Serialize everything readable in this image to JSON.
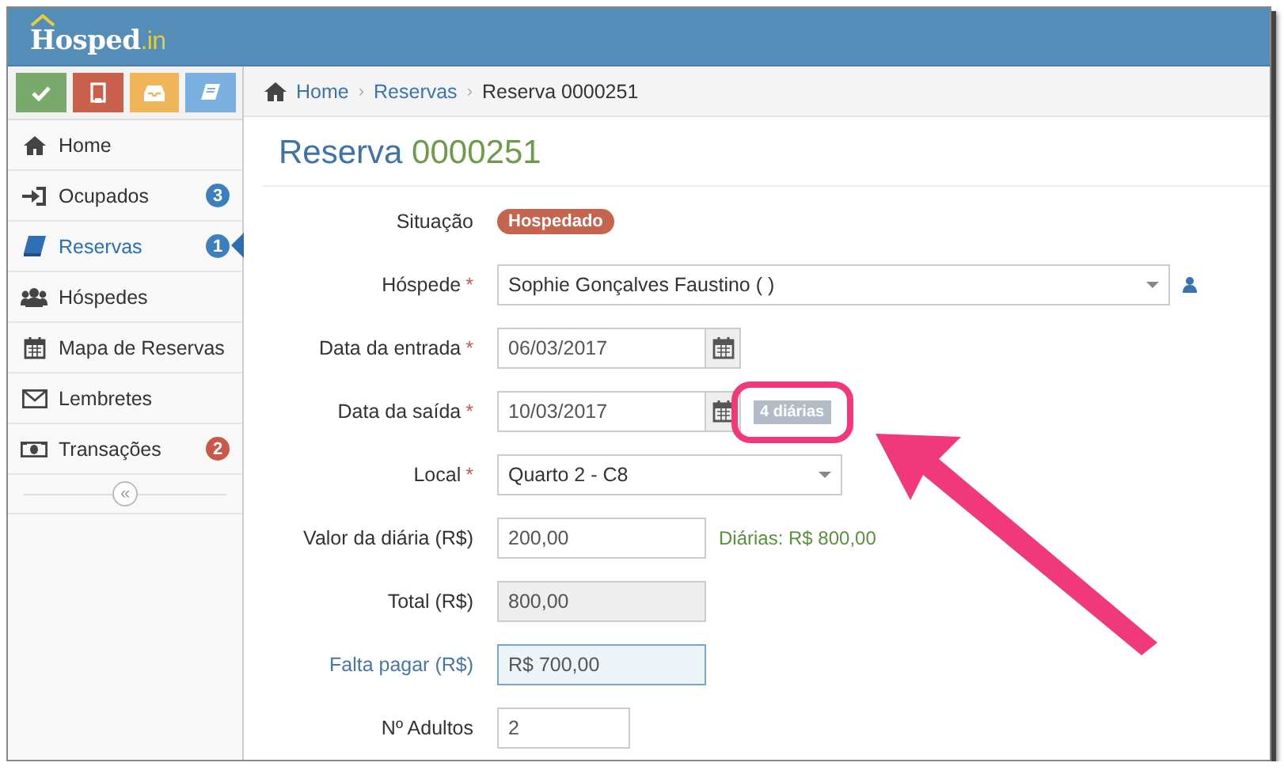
{
  "header": {
    "logo": "Hosped",
    "logo_suffix": ".in"
  },
  "quick_actions": [
    {
      "color": "#7aa96c"
    },
    {
      "color": "#c9604b"
    },
    {
      "color": "#f0b459"
    },
    {
      "color": "#7ab0df"
    }
  ],
  "sidebar": {
    "items": [
      {
        "label": "Home",
        "selected": false
      },
      {
        "label": "Ocupados",
        "selected": false,
        "count": "3",
        "color": "#3b7fbf"
      },
      {
        "label": "Reservas",
        "selected": true,
        "count": "1",
        "color": "#3b7fbf"
      },
      {
        "label": "Hóspedes",
        "selected": false
      },
      {
        "label": "Mapa de Reservas",
        "selected": false
      },
      {
        "label": "Lembretes",
        "selected": false
      },
      {
        "label": "Transações",
        "selected": false,
        "count": "2",
        "color": "#c9574a"
      }
    ],
    "collapse": "«"
  },
  "breadcrumb": [
    {
      "label": "Home"
    },
    {
      "separator": "›",
      "label": "Reservas"
    },
    {
      "separator": "›",
      "label": "Reserva 0000251"
    }
  ],
  "page_title": {
    "prefix": "Reserva",
    "number": "0000251"
  },
  "form": [
    {
      "kind": "badge",
      "label": "Situação",
      "value": "Hospedado"
    },
    {
      "kind": "guest",
      "label": "Hóspede",
      "required_mark": "*",
      "value": "Sophie Gonçalves Faustino ( )"
    },
    {
      "kind": "date",
      "label": "Data da entrada",
      "required_mark": "*",
      "value": "06/03/2017"
    },
    {
      "kind": "date",
      "label": "Data da saída",
      "required_mark": "*",
      "value": "10/03/2017",
      "tag": "4 diárias",
      "highlighted": true
    },
    {
      "kind": "select",
      "label": "Local",
      "required_mark": "*",
      "value": "Quarto 2 - C8"
    },
    {
      "kind": "text",
      "label": "Valor da diária (R$)",
      "value": "200,00",
      "note": "Diárias: R$ 800,00"
    },
    {
      "kind": "readonly",
      "label": "Total (R$)",
      "value": "800,00"
    },
    {
      "kind": "focused",
      "label": "Falta pagar (R$)",
      "value": "R$ 700,00"
    },
    {
      "kind": "small",
      "label": "Nº Adultos",
      "value": "2"
    }
  ]
}
